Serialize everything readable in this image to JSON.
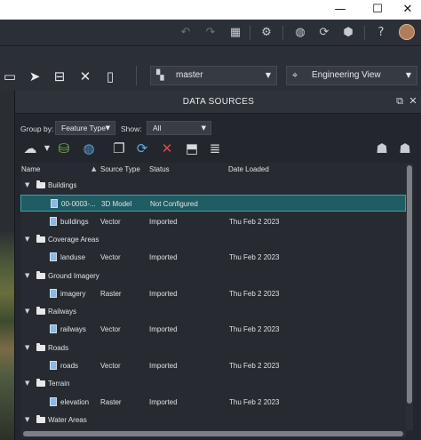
{
  "window": {
    "controls": {
      "minimize": "—",
      "maximize": "☐",
      "close": "✕"
    }
  },
  "topbar": {
    "icons": [
      "undo-icon",
      "redo-icon",
      "qr-code-icon",
      "settings-icon",
      "globe-icon",
      "sync-icon",
      "cube-icon",
      "help-icon",
      "avatar"
    ]
  },
  "toolbar": {
    "branch": "master",
    "view": "Engineering View"
  },
  "panel": {
    "title": "DATA SOURCES",
    "group_by_label": "Group by:",
    "group_by_value": "Feature Type",
    "show_label": "Show:",
    "show_value": "All",
    "columns": {
      "name": "Name",
      "source_type": "Source Type",
      "status": "Status",
      "date_loaded": "Date Loaded"
    }
  },
  "rows": [
    {
      "kind": "group",
      "name": "Buildings"
    },
    {
      "kind": "item",
      "name": "00-0003-...",
      "source_type": "3D Model",
      "status": "Not Configured",
      "date_loaded": "",
      "selected": true
    },
    {
      "kind": "item",
      "name": "buildings",
      "source_type": "Vector",
      "status": "Imported",
      "date_loaded": "Thu Feb 2 2023"
    },
    {
      "kind": "group",
      "name": "Coverage Areas"
    },
    {
      "kind": "item",
      "name": "landuse",
      "source_type": "Vector",
      "status": "Imported",
      "date_loaded": "Thu Feb 2 2023"
    },
    {
      "kind": "group",
      "name": "Ground Imagery"
    },
    {
      "kind": "item",
      "name": "imagery",
      "source_type": "Raster",
      "status": "Imported",
      "date_loaded": "Thu Feb 2 2023"
    },
    {
      "kind": "group",
      "name": "Railways"
    },
    {
      "kind": "item",
      "name": "railways",
      "source_type": "Vector",
      "status": "Imported",
      "date_loaded": "Thu Feb 2 2023"
    },
    {
      "kind": "group",
      "name": "Roads"
    },
    {
      "kind": "item",
      "name": "roads",
      "source_type": "Vector",
      "status": "Imported",
      "date_loaded": "Thu Feb 2 2023"
    },
    {
      "kind": "group",
      "name": "Terrain"
    },
    {
      "kind": "item",
      "name": "elevation",
      "source_type": "Raster",
      "status": "Imported",
      "date_loaded": "Thu Feb 2 2023"
    },
    {
      "kind": "group",
      "name": "Water Areas"
    }
  ],
  "colors": {
    "accent_selected": "#1f5c63",
    "delete_red": "#e04848",
    "refresh_blue": "#5aa7e6"
  }
}
